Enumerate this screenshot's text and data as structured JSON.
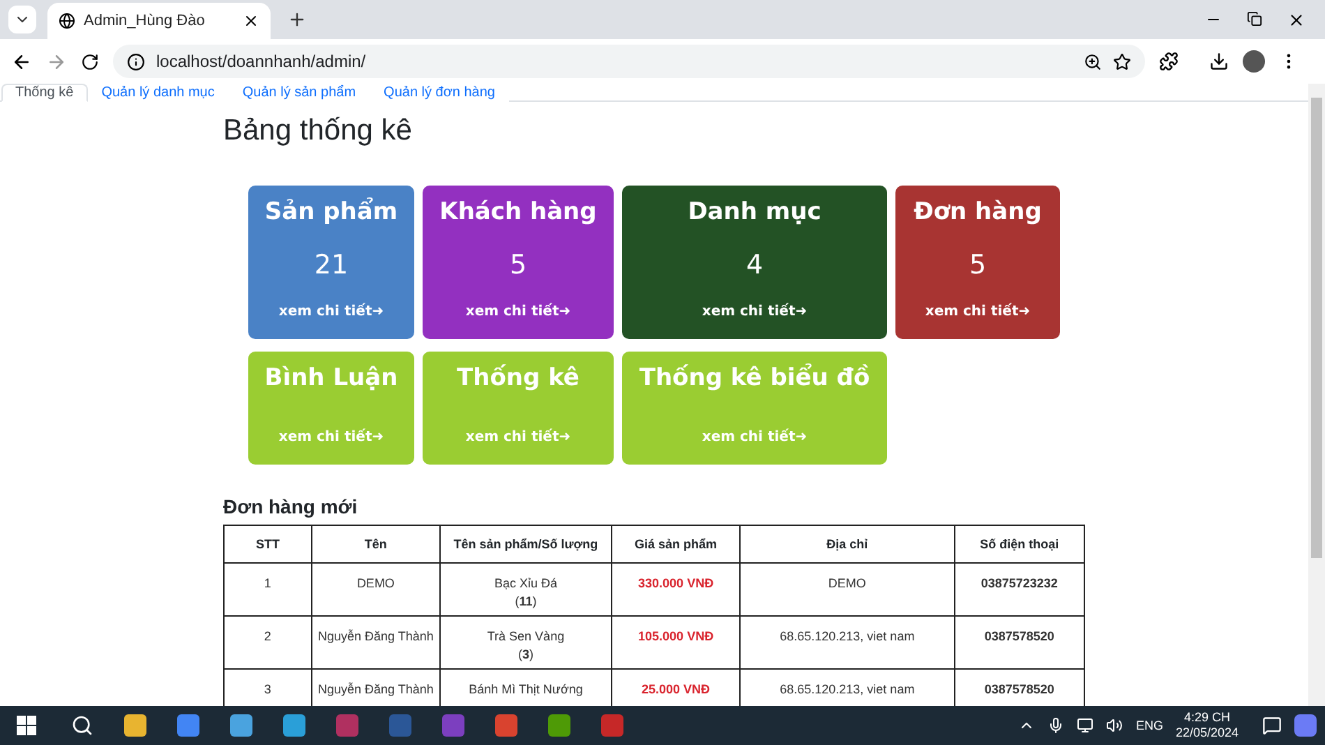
{
  "browser": {
    "tab_title": "Admin_Hùng Đào",
    "url": "localhost/doannhanh/admin/"
  },
  "nav_tabs": [
    {
      "label": "Thống kê",
      "selected": true
    },
    {
      "label": "Quản lý danh mục",
      "selected": false
    },
    {
      "label": "Quản lý sản phẩm",
      "selected": false
    },
    {
      "label": "Quản lý đơn hàng",
      "selected": false
    }
  ],
  "page_title": "Bảng thống kê",
  "cards": [
    {
      "title": "Sản phẩm",
      "count": "21",
      "link": "xem chi tiết➜",
      "color": "#4a82c6"
    },
    {
      "title": "Khách hàng",
      "count": "5",
      "link": "xem chi tiết➜",
      "color": "#9330c0"
    },
    {
      "title": "Danh mục",
      "count": "4",
      "link": "xem chi tiết➜",
      "color": "#235225"
    },
    {
      "title": "Đơn hàng",
      "count": "5",
      "link": "xem chi tiết➜",
      "color": "#a83432"
    },
    {
      "title": "Bình Luận",
      "link": "xem chi tiết➜",
      "color": "#9acd32"
    },
    {
      "title": "Thống kê",
      "link": "xem chi tiết➜",
      "color": "#9acd32"
    },
    {
      "title": "Thống kê biểu đồ",
      "link": "xem chi tiết➜",
      "color": "#9acd32"
    }
  ],
  "orders": {
    "title": "Đơn hàng mới",
    "columns": [
      "STT",
      "Tên",
      "Tên sản phẩm/Số lượng",
      "Giá sản phẩm",
      "Địa chỉ",
      "Số điện thoại"
    ],
    "rows": [
      {
        "stt": "1",
        "name": "DEMO",
        "product": "Bạc Xỉu Đá",
        "quantity": "(**11**)",
        "price": "330.000 VNĐ",
        "address": "DEMO",
        "phone": "03875723232"
      },
      {
        "stt": "2",
        "name": "Nguyễn Đăng Thành",
        "product": "Trà Sen Vàng",
        "quantity": "(**3**)",
        "price": "105.000 VNĐ",
        "address": "68.65.120.213, viet nam",
        "phone": "0387578520"
      },
      {
        "stt": "3",
        "name": "Nguyễn Đăng Thành",
        "product": "Bánh Mì Thịt Nướng",
        "price": "25.000 VNĐ",
        "address": "68.65.120.213, viet nam",
        "phone": "0387578520"
      }
    ]
  },
  "taskbar": {
    "language": "ENG",
    "time": "4:29 CH",
    "date": "22/05/2024"
  }
}
